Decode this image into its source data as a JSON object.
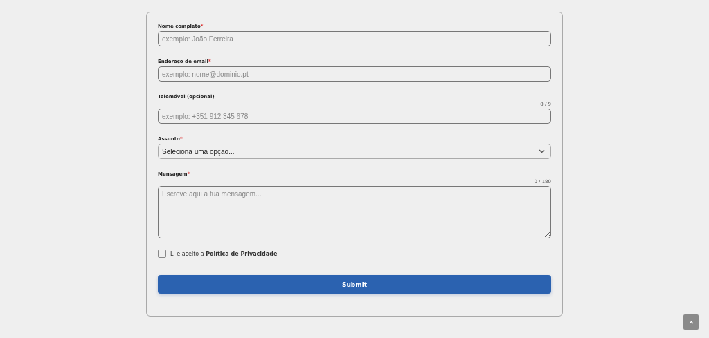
{
  "form": {
    "fields": [
      {
        "kind": "input",
        "label": "Nome completo",
        "required_mark": "*",
        "placeholder": "exemplo: João Ferreira"
      },
      {
        "kind": "input",
        "label": "Endereço de email",
        "required_mark": "*",
        "placeholder": "exemplo: nome@dominio.pt"
      },
      {
        "kind": "input",
        "label": "Telemóvel (opcional)",
        "counter": "0 / 9",
        "placeholder": "exemplo: +351 912 345 678"
      },
      {
        "kind": "select",
        "label": "Assunto",
        "required_mark": "*",
        "value": "Seleciona uma opção..."
      },
      {
        "kind": "textarea",
        "label": "Mensagem",
        "required_mark": "*",
        "counter": "0 / 180",
        "placeholder": "Escreve aqui a tua mensagem..."
      }
    ],
    "consent": {
      "checked": false,
      "text": "Li e aceito a **Política de Privacidade**"
    },
    "submit": "Submit"
  }
}
